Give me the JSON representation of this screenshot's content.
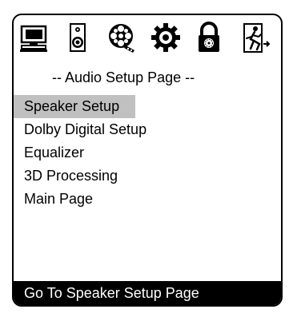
{
  "icon_bar": {
    "items": [
      {
        "icon": "monitor-icon"
      },
      {
        "icon": "speaker-icon"
      },
      {
        "icon": "film-reel-icon"
      },
      {
        "icon": "gear-icon"
      },
      {
        "icon": "padlock-icon"
      },
      {
        "icon": "exit-running-man-icon"
      }
    ]
  },
  "page": {
    "title": "-- Audio Setup Page --"
  },
  "menu": {
    "items": [
      {
        "label": "Speaker Setup",
        "selected": true
      },
      {
        "label": "Dolby Digital Setup",
        "selected": false
      },
      {
        "label": "Equalizer",
        "selected": false
      },
      {
        "label": "3D Processing",
        "selected": false
      },
      {
        "label": "Main Page",
        "selected": false
      }
    ]
  },
  "status": {
    "text": "Go To Speaker Setup Page"
  },
  "colors": {
    "background": "#ffffff",
    "selection": "#c0c0c0",
    "status_bar": "#000000",
    "status_text": "#ffffff"
  }
}
